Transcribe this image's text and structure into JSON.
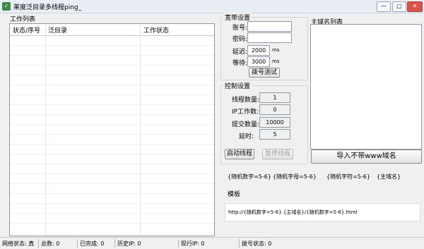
{
  "window": {
    "title": "莱度泛目录多线程ping_",
    "minimize_icon": "minimize-icon",
    "maximize_icon": "maximize-icon",
    "close_icon": "close-icon"
  },
  "work_list": {
    "label": "工作列表",
    "columns": [
      "状态/序号",
      "泛目录",
      "工作状态"
    ]
  },
  "broadband": {
    "title": "宽带设置",
    "account_label": "账号:",
    "account_value": "",
    "password_label": "密码:",
    "password_value": "",
    "delay_label": "延迟:",
    "delay_value": "2000",
    "delay_unit": "ms",
    "wait_label": "等待:",
    "wait_value": "3000",
    "wait_unit": "ms",
    "test_button": "拨号测试"
  },
  "control": {
    "title": "控制设置",
    "threads_label": "线程数量:",
    "threads_value": "1",
    "ip_work_label": "IP工作数:",
    "ip_work_value": "0",
    "submit_label": "提交数量:",
    "submit_value": "10000",
    "timeout_label": "延时:",
    "timeout_value": "5",
    "start_button": "启动线程",
    "pause_button": "暂停线程"
  },
  "domains": {
    "label": "主域名列表",
    "import_button": "导入不带www域名"
  },
  "variables": {
    "random_digits": "{随机数字=5-6}",
    "random_letters": "{随机字母=5-6}",
    "random_chars": "{随机字符=5-6}",
    "main_domain": "{主域名}"
  },
  "template": {
    "label": "模板",
    "value": "http://{随机数字=5-6}.{主域名}/{随机数字=5-6}.html"
  },
  "status": {
    "network": "网络状态: 真",
    "total": "总数: 0",
    "done": "已完成: 0",
    "history_ip": "历史IP: 0",
    "current_ip": "现行IP: 0",
    "dial": "拨号状态: 0"
  }
}
